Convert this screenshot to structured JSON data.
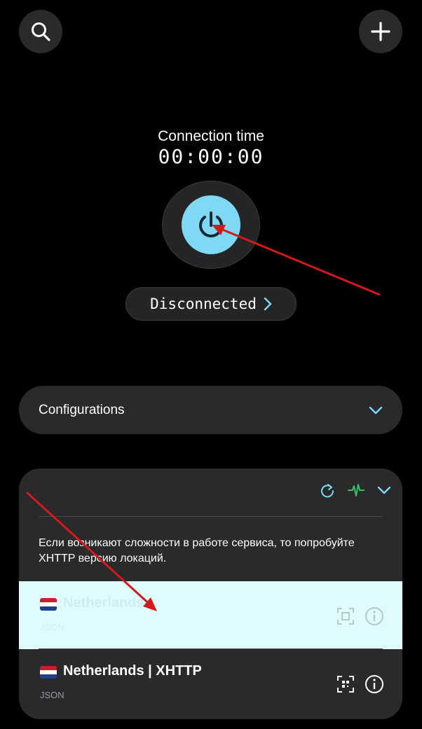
{
  "header": {
    "search_icon": "search-icon",
    "add_icon": "plus-icon"
  },
  "connection": {
    "time_label": "Connection time",
    "time_value": "00:00:00",
    "status_label": "Disconnected",
    "power_color": "#7fd9f5"
  },
  "configurations": {
    "label": "Configurations"
  },
  "group": {
    "note": "Если возникают сложности в работе сервиса, то попробуйте XHTTP версию локаций.",
    "servers": [
      {
        "flag": "Netherlands",
        "name": "Netherlands",
        "type": "JSON",
        "selected": true
      },
      {
        "flag": "Netherlands",
        "name": "Netherlands | XHTTP",
        "type": "JSON",
        "selected": false
      }
    ]
  },
  "colors": {
    "accent": "#7fd9f5",
    "ping": "#35c26b",
    "annotation": "#d11a1a"
  }
}
